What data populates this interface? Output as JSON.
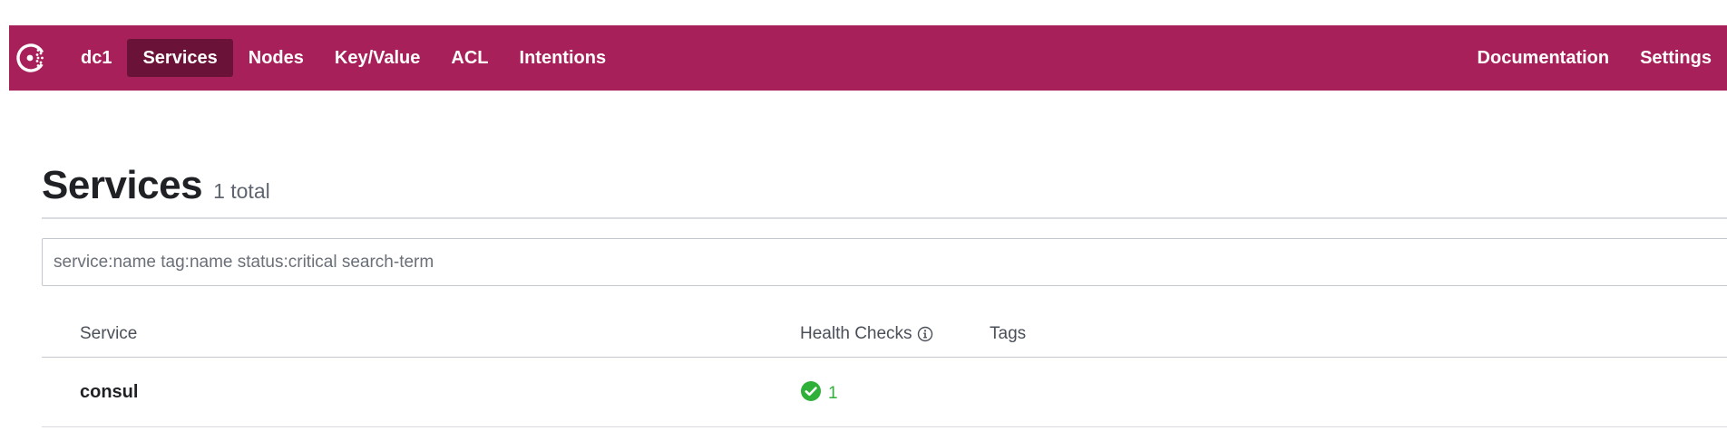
{
  "topnav": {
    "logo_icon": "consul-logo-icon",
    "datacenter": "dc1",
    "items": [
      {
        "label": "Services",
        "active": true
      },
      {
        "label": "Nodes",
        "active": false
      },
      {
        "label": "Key/Value",
        "active": false
      },
      {
        "label": "ACL",
        "active": false
      },
      {
        "label": "Intentions",
        "active": false
      }
    ],
    "right": {
      "documentation": "Documentation",
      "settings": "Settings"
    }
  },
  "page": {
    "title": "Services",
    "count": "1 total"
  },
  "search": {
    "placeholder": "service:name tag:name status:critical search-term",
    "value": ""
  },
  "table": {
    "columns": {
      "service": "Service",
      "health": "Health Checks",
      "tags": "Tags"
    },
    "rows": [
      {
        "service": "consul",
        "passing": "1",
        "status_icon": "check-circle-icon",
        "tags": ""
      }
    ]
  },
  "colors": {
    "brand": "#a8205a",
    "nav_active": "#6b1238",
    "passing": "#2eb039"
  }
}
